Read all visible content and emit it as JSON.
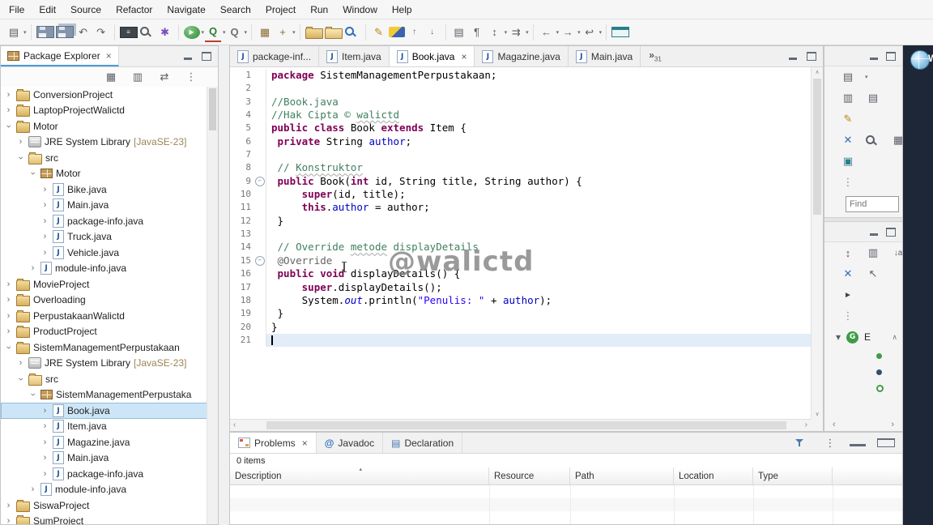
{
  "menubar": [
    "File",
    "Edit",
    "Source",
    "Refactor",
    "Navigate",
    "Search",
    "Project",
    "Run",
    "Window",
    "Help"
  ],
  "toolbar": {
    "groups": [
      {
        "icons": [
          {
            "n": "new-wizard-icon",
            "g": "▤",
            "dd": true
          }
        ]
      },
      {
        "icons": [
          {
            "n": "save-icon",
            "c": "ic-save"
          },
          {
            "n": "save-all-icon",
            "c": "ic-save ic-saveall"
          },
          {
            "n": "undo-icon",
            "g": "↶"
          },
          {
            "n": "redo-icon",
            "g": "↷"
          }
        ]
      },
      {
        "icons": [
          {
            "n": "open-console-icon",
            "c": "ic-console",
            "g": "≡"
          },
          {
            "n": "search-icon",
            "c": "ic-mag"
          },
          {
            "n": "external-tools-icon",
            "g": "✱",
            "c": "c-purple"
          }
        ]
      },
      {
        "icons": [
          {
            "n": "run-icon",
            "c": "ic-run",
            "g": "▶",
            "dd": true
          },
          {
            "n": "coverage-icon",
            "g": "Q",
            "c": "c-cov",
            "dd": true
          },
          {
            "n": "profile-icon",
            "g": "Q",
            "c": "c-prof",
            "dd": true
          }
        ]
      },
      {
        "icons": [
          {
            "n": "new-java-project-icon",
            "g": "▦",
            "c": "c-brown"
          },
          {
            "n": "new-package-icon",
            "g": "+",
            "c": "c-brown",
            "dd": true
          }
        ]
      },
      {
        "icons": [
          {
            "n": "folder-closed-icon",
            "c": "ic-folder"
          },
          {
            "n": "folder-open-icon",
            "c": "ic-folder open"
          },
          {
            "n": "flashlight-icon",
            "c": "ic-mag blue"
          }
        ]
      },
      {
        "icons": [
          {
            "n": "annotation-pen-icon",
            "g": "✎",
            "c": "c-pen"
          },
          {
            "n": "highlighter-icon",
            "c": "ic-hl"
          },
          {
            "n": "prev-annotation-icon",
            "g": "↑",
            "c": "c-small"
          },
          {
            "n": "next-annotation-icon",
            "g": "↓",
            "c": "c-small"
          }
        ]
      },
      {
        "icons": [
          {
            "n": "new-file-icon",
            "g": "▤"
          },
          {
            "n": "show-whitespace-icon",
            "g": "¶"
          },
          {
            "n": "sort-members-icon",
            "g": "↕",
            "dd": true
          },
          {
            "n": "shift-right-icon",
            "g": "⇉",
            "dd": true
          }
        ]
      },
      {
        "icons": [
          {
            "n": "back-icon",
            "g": "←",
            "dd": true
          },
          {
            "n": "forward-icon",
            "g": "→",
            "dd": true
          },
          {
            "n": "last-edit-location-icon",
            "g": "↩",
            "dd": true
          }
        ]
      },
      {
        "icons": [
          {
            "n": "open-new-window-icon",
            "c": "ic-nw"
          }
        ]
      }
    ]
  },
  "package_explorer": {
    "title": "Package Explorer",
    "close_glyph": "×",
    "toolbar_icons": [
      {
        "n": "expand-all-icon",
        "g": "▦"
      },
      {
        "n": "collapse-all-icon",
        "g": "▥"
      },
      {
        "n": "link-with-editor-icon",
        "g": "⇄"
      },
      {
        "n": "view-menu-icon",
        "g": "⋮"
      }
    ],
    "tree": [
      {
        "d": 0,
        "a": "c",
        "i": "prj",
        "t": "ConversionProject"
      },
      {
        "d": 0,
        "a": "c",
        "i": "prj",
        "t": "LaptopProjectWalictd"
      },
      {
        "d": 0,
        "a": "e",
        "i": "prj",
        "t": "Motor"
      },
      {
        "d": 1,
        "a": "c",
        "i": "jre",
        "t": "JRE System Library ",
        "suf": "[JavaSE-23]"
      },
      {
        "d": 1,
        "a": "e",
        "i": "src",
        "t": "src"
      },
      {
        "d": 2,
        "a": "e",
        "i": "pkg",
        "t": "Motor"
      },
      {
        "d": 3,
        "a": "c",
        "i": "jf",
        "t": "Bike.java"
      },
      {
        "d": 3,
        "a": "c",
        "i": "jf",
        "t": "Main.java"
      },
      {
        "d": 3,
        "a": "c",
        "i": "jf",
        "t": "package-info.java"
      },
      {
        "d": 3,
        "a": "c",
        "i": "jf",
        "t": "Truck.java"
      },
      {
        "d": 3,
        "a": "c",
        "i": "jf",
        "t": "Vehicle.java"
      },
      {
        "d": 2,
        "a": "c",
        "i": "jf",
        "t": "module-info.java"
      },
      {
        "d": 0,
        "a": "c",
        "i": "prj",
        "t": "MovieProject"
      },
      {
        "d": 0,
        "a": "c",
        "i": "prj",
        "t": "Overloading"
      },
      {
        "d": 0,
        "a": "c",
        "i": "prj",
        "t": "PerpustakaanWalictd"
      },
      {
        "d": 0,
        "a": "c",
        "i": "prj",
        "t": "ProductProject"
      },
      {
        "d": 0,
        "a": "e",
        "i": "prj",
        "t": "SistemManagementPerpustakaan"
      },
      {
        "d": 1,
        "a": "c",
        "i": "jre",
        "t": "JRE System Library ",
        "suf": "[JavaSE-23]"
      },
      {
        "d": 1,
        "a": "e",
        "i": "src",
        "t": "src"
      },
      {
        "d": 2,
        "a": "e",
        "i": "pkg",
        "t": "SistemManagementPerpustaka"
      },
      {
        "d": 3,
        "a": "c",
        "i": "jf",
        "t": "Book.java",
        "sel": true
      },
      {
        "d": 3,
        "a": "c",
        "i": "jf",
        "t": "Item.java"
      },
      {
        "d": 3,
        "a": "c",
        "i": "jf",
        "t": "Magazine.java"
      },
      {
        "d": 3,
        "a": "c",
        "i": "jf",
        "t": "Main.java"
      },
      {
        "d": 3,
        "a": "c",
        "i": "jf",
        "t": "package-info.java"
      },
      {
        "d": 2,
        "a": "c",
        "i": "jf",
        "t": "module-info.java"
      },
      {
        "d": 0,
        "a": "c",
        "i": "prj",
        "t": "SiswaProject"
      },
      {
        "d": 0,
        "a": "c",
        "i": "prj",
        "t": "SumProject"
      }
    ]
  },
  "editor": {
    "tabs": [
      {
        "label": "package-inf...",
        "active": false
      },
      {
        "label": "Item.java",
        "active": false
      },
      {
        "label": "Book.java",
        "active": true,
        "close": true
      },
      {
        "label": "Magazine.java",
        "active": false
      },
      {
        "label": "Main.java",
        "active": false
      }
    ],
    "overflow_chevron": "»",
    "overflow_count": "31",
    "watermark": "@walictd",
    "changed_lines": {
      "from": 14,
      "to": 19
    },
    "code": [
      {
        "n": "1",
        "segs": [
          [
            "k",
            "package"
          ],
          [
            "p",
            " SistemManagementPerpustakaan;"
          ]
        ]
      },
      {
        "n": "2",
        "segs": []
      },
      {
        "n": "3",
        "segs": [
          [
            "c",
            "//Book.java"
          ]
        ]
      },
      {
        "n": "4",
        "segs": [
          [
            "c",
            "//Hak Cipta © "
          ],
          [
            "c sp",
            "walictd"
          ]
        ]
      },
      {
        "n": "5",
        "segs": [
          [
            "k",
            "public"
          ],
          [
            "p",
            " "
          ],
          [
            "k",
            "class"
          ],
          [
            "p",
            " Book "
          ],
          [
            "k",
            "extends"
          ],
          [
            "p",
            " Item {"
          ]
        ]
      },
      {
        "n": "6",
        "segs": [
          [
            "p",
            " "
          ],
          [
            "k",
            "private"
          ],
          [
            "p",
            " String "
          ],
          [
            "f",
            "author"
          ],
          [
            "p",
            ";"
          ]
        ]
      },
      {
        "n": "7",
        "segs": []
      },
      {
        "n": "8",
        "segs": [
          [
            "p",
            " "
          ],
          [
            "c",
            "// "
          ],
          [
            "c sp",
            "Konstruktor"
          ]
        ]
      },
      {
        "n": "9",
        "fold": true,
        "segs": [
          [
            "p",
            " "
          ],
          [
            "k",
            "public"
          ],
          [
            "p",
            " Book("
          ],
          [
            "k",
            "int"
          ],
          [
            "p",
            " id, String title, String author) {"
          ]
        ]
      },
      {
        "n": "10",
        "segs": [
          [
            "p",
            "     "
          ],
          [
            "k",
            "super"
          ],
          [
            "p",
            "(id, title);"
          ]
        ]
      },
      {
        "n": "11",
        "segs": [
          [
            "p",
            "     "
          ],
          [
            "k",
            "this"
          ],
          [
            "p",
            "."
          ],
          [
            "f",
            "author"
          ],
          [
            "p",
            " = author;"
          ]
        ]
      },
      {
        "n": "12",
        "segs": [
          [
            "p",
            " }"
          ]
        ]
      },
      {
        "n": "13",
        "segs": []
      },
      {
        "n": "14",
        "segs": [
          [
            "p",
            " "
          ],
          [
            "c",
            "// Override "
          ],
          [
            "c sp",
            "metode"
          ],
          [
            "c",
            " displayDetails"
          ]
        ]
      },
      {
        "n": "15",
        "fold": true,
        "segs": [
          [
            "p",
            " "
          ],
          [
            "a",
            "@Override"
          ]
        ]
      },
      {
        "n": "16",
        "segs": [
          [
            "p",
            " "
          ],
          [
            "k",
            "public"
          ],
          [
            "p",
            " "
          ],
          [
            "k",
            "void"
          ],
          [
            "p",
            " displayDetails() {"
          ]
        ]
      },
      {
        "n": "17",
        "segs": [
          [
            "p",
            "     "
          ],
          [
            "k",
            "super"
          ],
          [
            "p",
            ".displayDetails();"
          ]
        ]
      },
      {
        "n": "18",
        "segs": [
          [
            "p",
            "     System."
          ],
          [
            "sf",
            "out"
          ],
          [
            "p",
            ".println("
          ],
          [
            "s",
            "\"Penulis: \""
          ],
          [
            "p",
            " + "
          ],
          [
            "f",
            "author"
          ],
          [
            "p",
            ");"
          ]
        ]
      },
      {
        "n": "19",
        "segs": [
          [
            "p",
            " }"
          ]
        ]
      },
      {
        "n": "20",
        "segs": [
          [
            "p",
            "}"
          ]
        ]
      },
      {
        "n": "21",
        "caret": true,
        "current": true,
        "segs": []
      }
    ]
  },
  "right_rail": {
    "sectionA_rows": [
      [
        {
          "n": "new-item-icon",
          "g": "▤",
          "dd": true
        }
      ],
      [
        {
          "n": "layout-horizontal-icon",
          "g": "▥"
        },
        {
          "n": "layout-vertical-icon",
          "g": "▤"
        }
      ],
      [
        {
          "n": "edit-pen-icon",
          "g": "✎",
          "c": "c-pen"
        }
      ],
      [
        {
          "n": "delete-icon",
          "g": "✕",
          "c": "c-blue"
        },
        {
          "n": "search-small-icon",
          "c": "ic-mag"
        },
        {
          "n": "grid-small-icon",
          "g": "▦"
        }
      ],
      [
        {
          "n": "import-icon",
          "g": "▣",
          "c": "c-teal"
        }
      ],
      [
        {
          "n": "drag-handle-icon",
          "g": "⋮",
          "c": "c-dots"
        }
      ]
    ],
    "find_placeholder": "Find",
    "sectionB_rows": [
      [
        {
          "n": "sort-icon",
          "g": "↕"
        },
        {
          "n": "columns-icon",
          "g": "▥"
        },
        {
          "n": "sort-az-icon",
          "g": "↓a",
          "c": "c-small"
        }
      ],
      [
        {
          "n": "clear-icon",
          "g": "✕",
          "c": "c-blue"
        },
        {
          "n": "nav-up-icon",
          "g": "↖"
        }
      ],
      [
        {
          "n": "select-arrow-icon",
          "g": "►",
          "c": "c-dark"
        }
      ],
      [
        {
          "n": "drag-handle-icon",
          "g": "⋮",
          "c": "c-dots"
        }
      ]
    ],
    "tree_header": {
      "chevron": "▾",
      "badge": "G",
      "label": "E",
      "up": "∧"
    },
    "status_dots": [
      "green",
      "dark",
      "ring"
    ],
    "hscroll_left": "‹",
    "hscroll_right": "›"
  },
  "problems": {
    "tabs": [
      {
        "label": "Problems",
        "icon": "problems-icon",
        "active": true,
        "close": true
      },
      {
        "label": "Javadoc",
        "icon": "javadoc-icon",
        "active": false
      },
      {
        "label": "Declaration",
        "icon": "declaration-icon",
        "active": false
      }
    ],
    "right_icons": [
      {
        "n": "filter-icon",
        "c": "ic-funnel"
      },
      {
        "n": "view-menu-icon",
        "g": "⋮"
      },
      {
        "n": "minimize-icon",
        "c": "ic-min"
      },
      {
        "n": "maximize-icon",
        "c": "ic-max"
      }
    ],
    "items_count": "0 items",
    "columns": [
      "Description",
      "Resource",
      "Path",
      "Location",
      "Type"
    ],
    "sort_glyph": "▴"
  },
  "taskbar": {
    "globe_letter": "W"
  },
  "colors": {
    "keyword": "#7f0055",
    "comment": "#3f7f5f",
    "string": "#2a00ff",
    "field": "#0000c0",
    "annotation": "#646464",
    "selection_bg": "#cde6f7",
    "current_line": "#e3edf9",
    "view_tab_underline": "#4f9bd5",
    "watermark": "#7e7e7e",
    "run_green": "#2e8b34",
    "dark_strip": "#1e2737"
  }
}
